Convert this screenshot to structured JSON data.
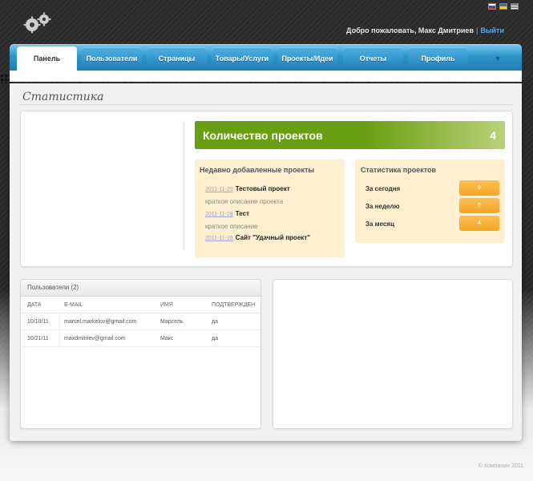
{
  "header": {
    "welcome_text": "Добро пожаловать, Макс Дмитриев",
    "exit_link": "Выйти",
    "flags": [
      "ru",
      "ua",
      "us"
    ]
  },
  "nav": {
    "tabs": [
      {
        "label": "Панель",
        "active": true
      },
      {
        "label": "Пользователи",
        "active": false
      },
      {
        "label": "Страницы",
        "active": false
      },
      {
        "label": "Товары/Услуги",
        "active": false
      },
      {
        "label": "Проекты/Идеи",
        "active": false
      },
      {
        "label": "Отчеты",
        "active": false
      },
      {
        "label": "Профиль",
        "active": false
      }
    ],
    "more_icon": "chevron-down-icon"
  },
  "page": {
    "title": "Статистика"
  },
  "projects": {
    "count_label": "Количество проектов",
    "count_value": "4",
    "recent_title": "Недавно добавленные проекты",
    "recent": [
      {
        "date": "2011-11-29",
        "name": "Тестовый проект",
        "description": "краткое описание проекта"
      },
      {
        "date": "2011-11-28",
        "name": "Тест",
        "description": "краткое описание"
      },
      {
        "date": "2011-11-28",
        "name": "Сайт \"Удачный проект\"",
        "description": ""
      }
    ],
    "stats_title": "Статистика проектов",
    "stats": [
      {
        "label": "За сегодня",
        "value": "0"
      },
      {
        "label": "За неделю",
        "value": "0"
      },
      {
        "label": "За месяц",
        "value": "4"
      }
    ]
  },
  "users": {
    "title": "Пользователи (2)",
    "columns": [
      "Дата",
      "E-mail",
      "Имя",
      "Подтвержден"
    ],
    "rows": [
      {
        "date": "10/10/11",
        "email": "marsel.markelov@gmail.com",
        "name": "Марсель",
        "confirmed": "да"
      },
      {
        "date": "10/21/11",
        "email": "maxdmitriev@gmail.com",
        "name": "Макс",
        "confirmed": "да"
      }
    ]
  },
  "footer": {
    "copyright": "© Компания 2011"
  },
  "colors": {
    "nav_blue": "#2f95c9",
    "green_bar": "#6a9e12",
    "orange_badge": "#f5a524",
    "cream_box": "#feefd0"
  }
}
